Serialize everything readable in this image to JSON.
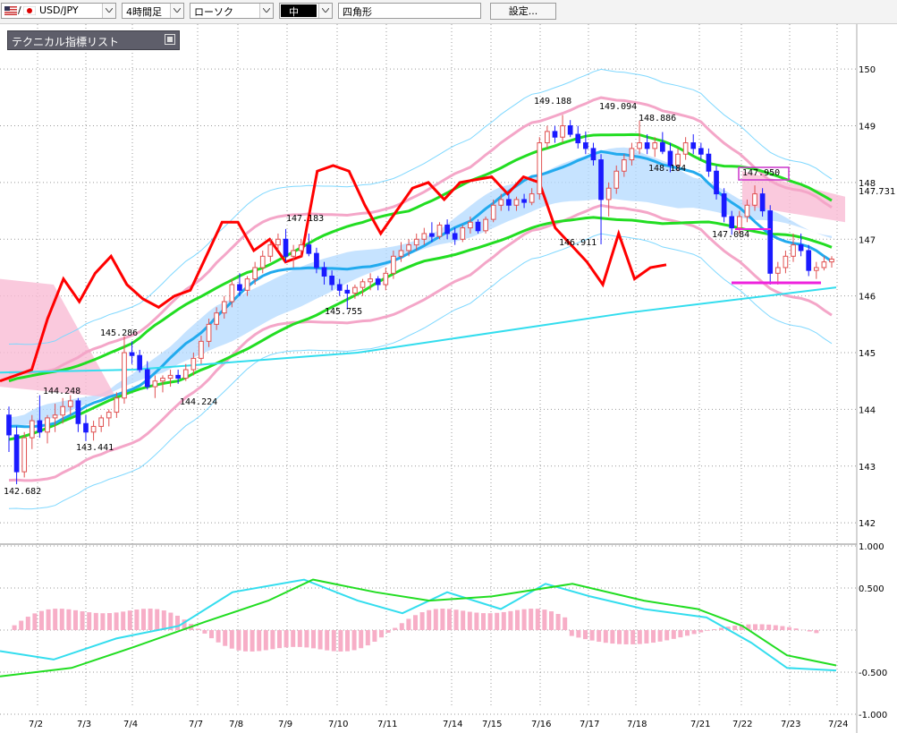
{
  "toolbar": {
    "symbol": "USD/JPY",
    "timeframe": "4時間足",
    "chart_style": "ローソク",
    "draw_color": "中",
    "draw_tool": "四角形",
    "settings_label": "設定..."
  },
  "indicator_panel": {
    "title": "テクニカル指標リスト"
  },
  "colors": {
    "bull_candle": "#e05050",
    "bear_candle": "#1a1aff",
    "cloud": "#b3d9ff",
    "bollinger_outer": "#7fd8ff",
    "bollinger_inner": "#f4a6c8",
    "ma_green": "#22dd22",
    "ma_blue": "#22aaee",
    "chikou_red": "#ff0000",
    "highlight_box": "#cc33cc"
  },
  "chart_data": {
    "type": "line",
    "price_axis": {
      "ylim": [
        141.75,
        150.35
      ],
      "ticks": [
        "150",
        "149",
        "148",
        "147",
        "146",
        "145",
        "144",
        "143",
        "142"
      ],
      "current_price": "147.731"
    },
    "date_labels": [
      "7/2",
      "7/3",
      "7/4",
      "7/7",
      "7/8",
      "7/9",
      "7/10",
      "7/11",
      "7/14",
      "7/15",
      "7/16",
      "7/17",
      "7/18",
      "7/21",
      "7/22",
      "7/23",
      "7/24"
    ],
    "annotations": [
      "142.682",
      "144.248",
      "143.441",
      "145.286",
      "144.224",
      "147.183",
      "145.755",
      "149.188",
      "149.094",
      "148.886",
      "146.911",
      "148.184",
      "147.950",
      "147.084"
    ],
    "candles": [
      [
        143.9,
        144.05,
        143.25,
        143.55
      ],
      [
        143.55,
        143.7,
        142.68,
        142.9
      ],
      [
        142.9,
        143.6,
        142.8,
        143.5
      ],
      [
        143.5,
        143.9,
        143.3,
        143.8
      ],
      [
        143.8,
        144.25,
        143.5,
        143.6
      ],
      [
        143.6,
        143.9,
        143.4,
        143.85
      ],
      [
        143.85,
        144.1,
        143.6,
        143.9
      ],
      [
        143.9,
        144.2,
        143.75,
        144.05
      ],
      [
        144.05,
        144.25,
        143.9,
        144.15
      ],
      [
        144.15,
        144.2,
        143.6,
        143.75
      ],
      [
        143.75,
        143.9,
        143.44,
        143.6
      ],
      [
        143.6,
        143.8,
        143.45,
        143.7
      ],
      [
        143.7,
        143.9,
        143.6,
        143.85
      ],
      [
        143.85,
        144.0,
        143.7,
        143.95
      ],
      [
        143.95,
        144.3,
        143.85,
        144.2
      ],
      [
        144.2,
        145.29,
        144.1,
        145.0
      ],
      [
        145.0,
        145.2,
        144.8,
        144.95
      ],
      [
        144.95,
        145.05,
        144.65,
        144.7
      ],
      [
        144.7,
        144.85,
        144.35,
        144.4
      ],
      [
        144.4,
        144.6,
        144.2,
        144.5
      ],
      [
        144.5,
        144.6,
        144.3,
        144.55
      ],
      [
        144.55,
        144.7,
        144.4,
        144.6
      ],
      [
        144.6,
        144.7,
        144.45,
        144.55
      ],
      [
        144.55,
        144.8,
        144.5,
        144.7
      ],
      [
        144.7,
        145.0,
        144.6,
        144.9
      ],
      [
        144.9,
        145.3,
        144.8,
        145.2
      ],
      [
        145.2,
        145.6,
        145.1,
        145.5
      ],
      [
        145.5,
        145.8,
        145.4,
        145.7
      ],
      [
        145.7,
        146.0,
        145.6,
        145.9
      ],
      [
        145.9,
        146.3,
        145.8,
        146.2
      ],
      [
        146.2,
        146.4,
        146.0,
        146.1
      ],
      [
        146.1,
        146.35,
        146.0,
        146.3
      ],
      [
        146.3,
        146.6,
        146.2,
        146.5
      ],
      [
        146.5,
        146.8,
        146.4,
        146.7
      ],
      [
        146.7,
        147.0,
        146.6,
        146.9
      ],
      [
        146.9,
        147.1,
        146.8,
        147.0
      ],
      [
        147.0,
        147.18,
        146.6,
        146.7
      ],
      [
        146.7,
        146.9,
        146.5,
        146.8
      ],
      [
        146.8,
        147.0,
        146.7,
        146.9
      ],
      [
        146.9,
        147.1,
        146.7,
        146.75
      ],
      [
        146.75,
        146.85,
        146.4,
        146.5
      ],
      [
        146.5,
        146.6,
        146.2,
        146.35
      ],
      [
        146.35,
        146.45,
        146.1,
        146.2
      ],
      [
        146.2,
        146.3,
        146.0,
        146.1
      ],
      [
        146.1,
        146.2,
        145.76,
        146.05
      ],
      [
        146.05,
        146.2,
        145.95,
        146.15
      ],
      [
        146.15,
        146.3,
        146.0,
        146.25
      ],
      [
        146.25,
        146.4,
        146.1,
        146.3
      ],
      [
        146.3,
        146.35,
        146.1,
        146.2
      ],
      [
        146.2,
        146.5,
        146.1,
        146.4
      ],
      [
        146.4,
        146.8,
        146.3,
        146.7
      ],
      [
        146.7,
        146.95,
        146.6,
        146.8
      ],
      [
        146.8,
        147.0,
        146.7,
        146.9
      ],
      [
        146.9,
        147.1,
        146.8,
        147.0
      ],
      [
        147.0,
        147.2,
        146.9,
        147.1
      ],
      [
        147.1,
        147.3,
        146.95,
        147.05
      ],
      [
        147.05,
        147.3,
        147.0,
        147.25
      ],
      [
        147.25,
        147.35,
        147.0,
        147.1
      ],
      [
        147.1,
        147.2,
        146.9,
        147.0
      ],
      [
        147.0,
        147.25,
        146.95,
        147.2
      ],
      [
        147.2,
        147.4,
        147.1,
        147.3
      ],
      [
        147.3,
        147.35,
        147.1,
        147.15
      ],
      [
        147.15,
        147.4,
        147.1,
        147.35
      ],
      [
        147.35,
        147.7,
        147.3,
        147.6
      ],
      [
        147.6,
        147.8,
        147.5,
        147.7
      ],
      [
        147.7,
        147.8,
        147.5,
        147.6
      ],
      [
        147.6,
        147.75,
        147.5,
        147.7
      ],
      [
        147.7,
        147.8,
        147.55,
        147.65
      ],
      [
        147.65,
        147.9,
        147.6,
        147.8
      ],
      [
        147.8,
        148.8,
        147.7,
        148.7
      ],
      [
        148.7,
        149.0,
        148.6,
        148.9
      ],
      [
        148.9,
        149.0,
        148.7,
        148.8
      ],
      [
        148.8,
        149.19,
        148.7,
        149.0
      ],
      [
        149.0,
        149.1,
        148.8,
        148.85
      ],
      [
        148.85,
        149.0,
        148.6,
        148.7
      ],
      [
        148.7,
        148.9,
        148.5,
        148.6
      ],
      [
        148.6,
        148.7,
        148.3,
        148.4
      ],
      [
        148.4,
        148.5,
        146.91,
        147.7
      ],
      [
        147.7,
        148.0,
        147.4,
        147.9
      ],
      [
        147.9,
        148.3,
        147.8,
        148.2
      ],
      [
        148.2,
        148.5,
        148.1,
        148.4
      ],
      [
        148.4,
        148.7,
        148.3,
        148.6
      ],
      [
        148.6,
        149.09,
        148.5,
        148.7
      ],
      [
        148.7,
        148.85,
        148.5,
        148.6
      ],
      [
        148.6,
        148.8,
        148.45,
        148.7
      ],
      [
        148.7,
        148.89,
        148.5,
        148.55
      ],
      [
        148.55,
        148.7,
        148.18,
        148.3
      ],
      [
        148.3,
        148.6,
        148.2,
        148.5
      ],
      [
        148.5,
        148.8,
        148.4,
        148.7
      ],
      [
        148.7,
        148.85,
        148.5,
        148.6
      ],
      [
        148.6,
        148.7,
        148.4,
        148.5
      ],
      [
        148.5,
        148.6,
        148.1,
        148.2
      ],
      [
        148.2,
        148.3,
        147.7,
        147.8
      ],
      [
        147.8,
        147.9,
        147.3,
        147.4
      ],
      [
        147.4,
        147.5,
        147.08,
        147.2
      ],
      [
        147.2,
        147.5,
        147.1,
        147.4
      ],
      [
        147.4,
        147.7,
        147.3,
        147.6
      ],
      [
        147.6,
        147.95,
        147.5,
        147.8
      ],
      [
        147.8,
        147.9,
        147.4,
        147.5
      ],
      [
        147.5,
        147.6,
        146.2,
        146.4
      ],
      [
        146.4,
        146.6,
        146.2,
        146.5
      ],
      [
        146.5,
        146.8,
        146.4,
        146.7
      ],
      [
        146.7,
        147.1,
        146.6,
        146.9
      ],
      [
        146.9,
        147.1,
        146.7,
        146.8
      ],
      [
        146.8,
        146.9,
        146.35,
        146.45
      ],
      [
        146.45,
        146.6,
        146.3,
        146.5
      ],
      [
        146.5,
        146.7,
        146.45,
        146.6
      ],
      [
        146.6,
        146.7,
        146.5,
        146.65
      ]
    ],
    "oscillator": {
      "ylim": [
        -1.0,
        1.0
      ],
      "ticks": [
        "1.000",
        "0.500",
        "-0.500",
        "-1.000"
      ]
    }
  }
}
